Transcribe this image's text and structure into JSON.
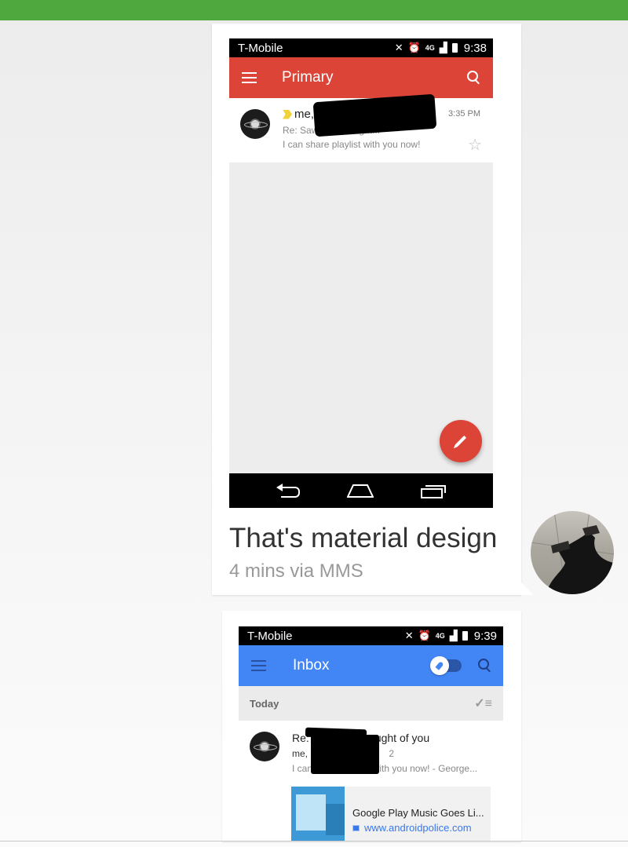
{
  "message1": {
    "screenshot": {
      "status_bar": {
        "carrier": "T-Mobile",
        "network": "4G",
        "time": "9:38"
      },
      "appbar": {
        "title": "Primary",
        "color": "#db4437"
      },
      "email": {
        "sender": "me,",
        "time": "3:35 PM",
        "subject": "Re: Saw this, thought...",
        "snippet": "I can share playlist with you now!"
      }
    },
    "text": "That's material design",
    "meta": "4 mins via MMS"
  },
  "message2": {
    "screenshot": {
      "status_bar": {
        "carrier": "T-Mobile",
        "network": "4G",
        "time": "9:39"
      },
      "appbar": {
        "title": "Inbox",
        "color": "#4285f4"
      },
      "section": "Today",
      "email": {
        "subject": "Re: Saw this, thought of you",
        "sender": "me,",
        "count": "2",
        "snippet": "I can share playlist with you now! - George..."
      },
      "link": {
        "title": "Google Play Music Goes Li...",
        "url": "www.androidpolice.com"
      }
    }
  },
  "colors": {
    "top_bar": "#4fa83d"
  }
}
